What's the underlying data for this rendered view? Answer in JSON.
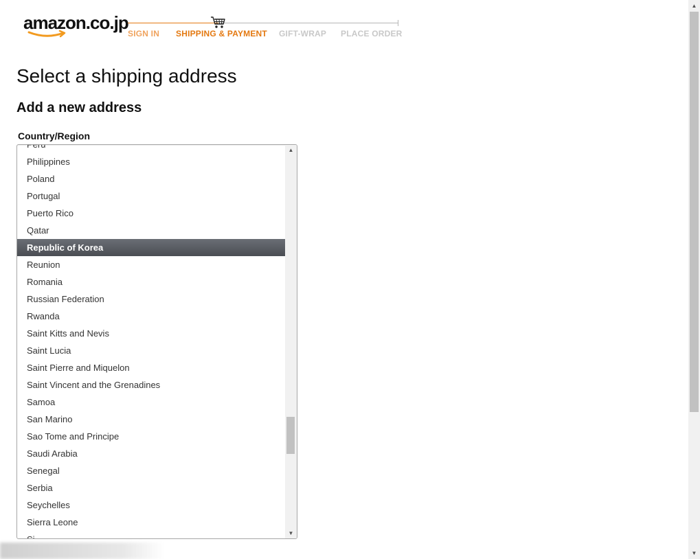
{
  "header": {
    "logo_text": "amazon.co.jp",
    "brand_color": "#e47911",
    "steps": [
      {
        "label": "SIGN IN",
        "state": "done"
      },
      {
        "label": "SHIPPING & PAYMENT",
        "state": "active"
      },
      {
        "label": "GIFT-WRAP",
        "state": "todo"
      },
      {
        "label": "PLACE ORDER",
        "state": "todo"
      }
    ],
    "cart_icon": "cart-icon"
  },
  "main": {
    "title": "Select a shipping address",
    "section_title": "Add a new address",
    "country_label": "Country/Region"
  },
  "country_list": {
    "selected": "Republic of Korea",
    "items": [
      "Peru",
      "Philippines",
      "Poland",
      "Portugal",
      "Puerto Rico",
      "Qatar",
      "Republic of Korea",
      "Reunion",
      "Romania",
      "Russian Federation",
      "Rwanda",
      "Saint Kitts and Nevis",
      "Saint Lucia",
      "Saint Pierre and Miquelon",
      "Saint Vincent and the Grenadines",
      "Samoa",
      "San Marino",
      "Sao Tome and Principe",
      "Saudi Arabia",
      "Senegal",
      "Serbia",
      "Seychelles",
      "Sierra Leone",
      "Si"
    ],
    "selected_bg": "#55585e"
  }
}
